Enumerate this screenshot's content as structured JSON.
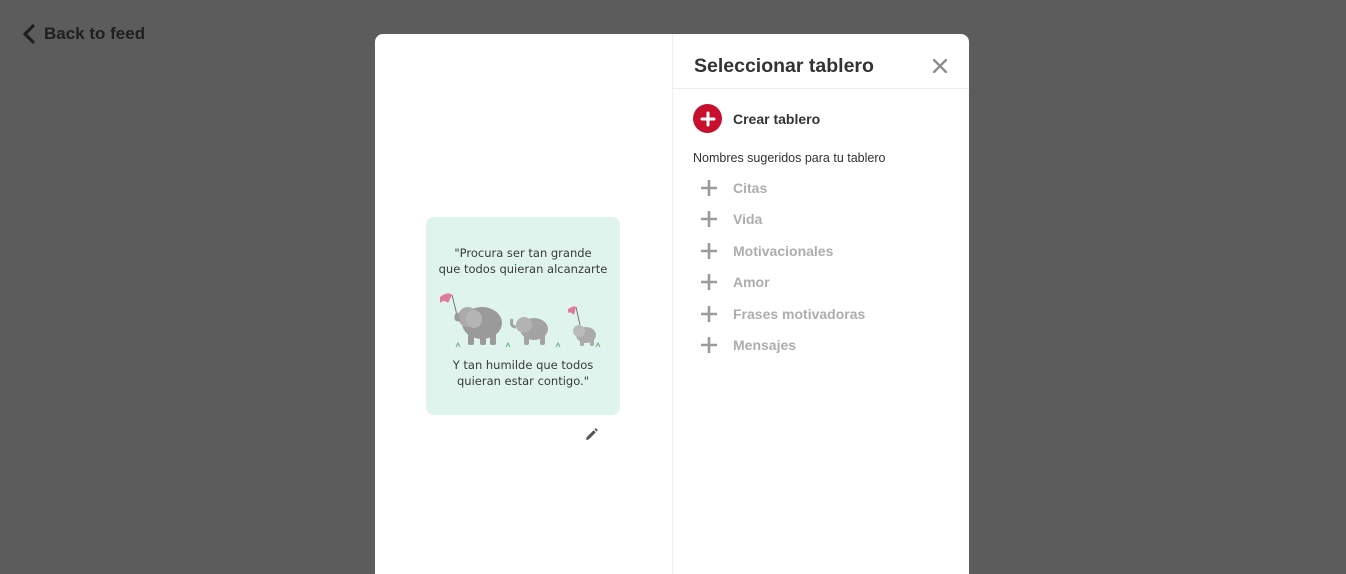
{
  "nav": {
    "back_label": "Back to feed"
  },
  "pin": {
    "quote_top_line1": "\"Procura ser tan grande",
    "quote_top_line2": "que todos quieran alcanzarte",
    "quote_bottom_line1": "Y tan humilde que todos",
    "quote_bottom_line2": "quieran estar contigo.\""
  },
  "dialog": {
    "title": "Seleccionar tablero",
    "create_label": "Crear tablero",
    "suggestions_title": "Nombres sugeridos para tu tablero",
    "suggestions": [
      {
        "label": "Citas"
      },
      {
        "label": "Vida"
      },
      {
        "label": "Motivacionales"
      },
      {
        "label": "Amor"
      },
      {
        "label": "Frases motivadoras"
      },
      {
        "label": "Mensajes"
      }
    ]
  },
  "colors": {
    "overlay": "#5c5c5c",
    "accent_red": "#c8102e",
    "pin_background": "#dff4ec",
    "suggestion_text": "#adadad"
  }
}
